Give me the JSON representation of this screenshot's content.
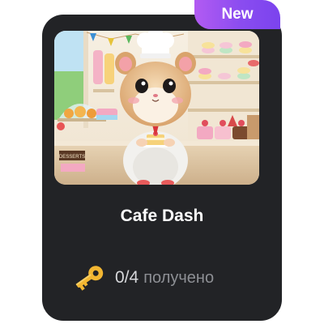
{
  "card": {
    "badge": "New",
    "title": "Cafe Dash",
    "image": {
      "alt": "hamster-chef-illustration",
      "sign_text": "DESSERTS"
    },
    "progress": {
      "icon": "key-icon",
      "value": "0/4",
      "label": "получено"
    }
  },
  "colors": {
    "card_background": "#222326",
    "badge_gradient_start": "#b25bf2",
    "badge_gradient_end": "#7b43ee",
    "title_text": "#ffffff",
    "secondary_text": "#8d8f94",
    "key_gold": "#f2b632"
  }
}
